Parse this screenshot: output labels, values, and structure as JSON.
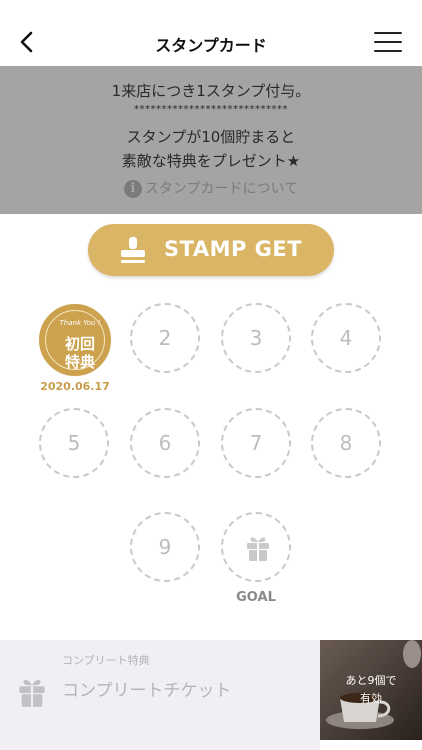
{
  "nav": {
    "title": "スタンプカード"
  },
  "info": {
    "line1": "1来店につき1スタンプ付与。",
    "stars": "****************************",
    "line2": "スタンプが10個貯まると",
    "line3": "素敵な特典をプレゼント★",
    "link": "スタンプカードについて",
    "icon": "i"
  },
  "stamp_button": {
    "label": "STAMP GET"
  },
  "stamps": {
    "first": {
      "thank_you": "Thank You !",
      "line1": "初回",
      "line2": "特典",
      "date": "2020.06.17"
    },
    "slots": [
      "2",
      "3",
      "4",
      "5",
      "6",
      "7",
      "8",
      "9"
    ],
    "goal_label": "GOAL"
  },
  "complete": {
    "caption": "コンプリート特典",
    "ticket": "コンプリートチケット",
    "remaining_line1": "あと9個で",
    "remaining_line2": "有効"
  },
  "colors": {
    "gold": "#d9b565",
    "panel_gray": "#a4a4a4",
    "dashed": "#c9c9c9"
  }
}
